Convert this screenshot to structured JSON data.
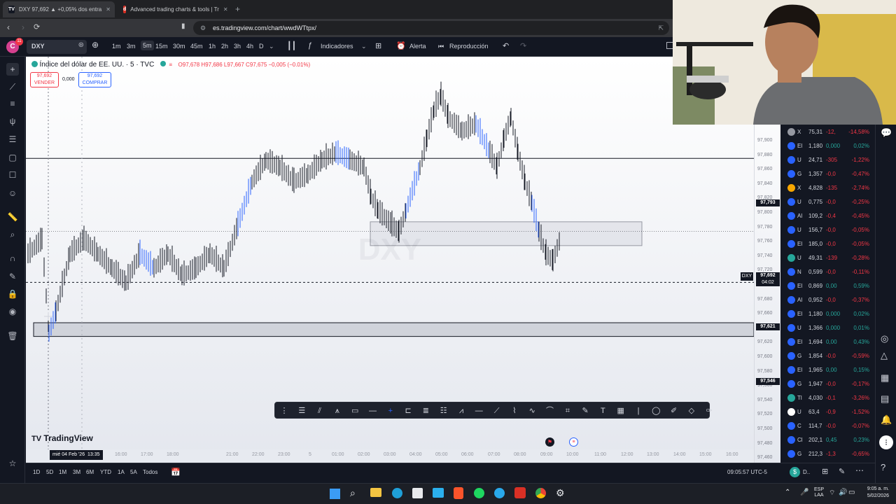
{
  "browser": {
    "tab1": "DXY 97,692 ▲ +0,05% dos entra",
    "tab2": "Advanced trading charts & tools | Tr",
    "url": "es.tradingview.com/chart/wwdWTtpx/"
  },
  "toolbar": {
    "avatar_letter": "C",
    "avatar_badge": "11",
    "symbol": "DXY",
    "timeframes": [
      "1m",
      "3m",
      "5m",
      "15m",
      "30m",
      "45m",
      "1h",
      "2h",
      "3h",
      "4h",
      "D"
    ],
    "active_timeframe": "5m",
    "indicators_label": "Indicadores",
    "alert_label": "Alerta",
    "replay_label": "Reproducción"
  },
  "legend": {
    "title": "Índice del dólar de EE. UU. · 5 · TVC",
    "ohlc": "O97,678 H97,686 L97,667 C97,675 −0,005 (−0.01%)",
    "sell_price": "97,692",
    "sell_label": "VENDER",
    "spread": "0,000",
    "buy_price": "97,692",
    "buy_label": "COMPRAR"
  },
  "price_scale": {
    "labels": [
      "97,900",
      "97,880",
      "97,860",
      "97,840",
      "97,820",
      "97,800",
      "97,780",
      "97,760",
      "97,740",
      "97,720",
      "97,700",
      "97,680",
      "97,660",
      "97,640",
      "97,620",
      "97,600",
      "97,580",
      "97,560",
      "97,540",
      "97,520",
      "97,500",
      "97,480",
      "97,460"
    ],
    "tag_upper": "97,793",
    "current_symbol": "DXY",
    "current_price": "97,692",
    "current_countdown": "04:02",
    "tag_cross": "97,621",
    "tag_lower": "97,546"
  },
  "time_axis": {
    "labels": [
      "12:00",
      "16:00",
      "17:00",
      "18:00",
      "21:00",
      "22:00",
      "23:00",
      "5",
      "01:00",
      "02:00",
      "03:00",
      "04:00",
      "05:00",
      "06:00",
      "07:00",
      "08:00",
      "09:00",
      "10:00",
      "11:00",
      "12:00",
      "13:00",
      "14:00",
      "15:00",
      "16:00"
    ],
    "cursor_date": "mié 04 Feb '26",
    "cursor_time": "13:35"
  },
  "brand": "TradingView",
  "bottom": {
    "ranges": [
      "1D",
      "5D",
      "1M",
      "3M",
      "6M",
      "YTD",
      "1A",
      "5A",
      "Todos"
    ],
    "clock": "09:05:57 UTC-5"
  },
  "watchlist": [
    {
      "s": "X",
      "p": "75,31",
      "c": "-12,",
      "pc": "-14,58%",
      "color": "#9598a1",
      "up": false
    },
    {
      "s": "El",
      "p": "1,180",
      "c": "0,000",
      "pc": "0,02%",
      "color": "#2962ff",
      "up": true
    },
    {
      "s": "U",
      "p": "24,71",
      "c": "-305",
      "pc": "-1,22%",
      "color": "#2962ff",
      "up": false
    },
    {
      "s": "G",
      "p": "1,357",
      "c": "-0,0",
      "pc": "-0,47%",
      "color": "#2962ff",
      "up": false
    },
    {
      "s": "X",
      "p": "4,828",
      "c": "-135",
      "pc": "-2,74%",
      "color": "#f7a600",
      "up": false
    },
    {
      "s": "U",
      "p": "0,775",
      "c": "-0,0",
      "pc": "-0,25%",
      "color": "#2962ff",
      "up": false
    },
    {
      "s": "Al",
      "p": "109,2",
      "c": "-0,4",
      "pc": "-0,45%",
      "color": "#2962ff",
      "up": false
    },
    {
      "s": "U",
      "p": "156,7",
      "c": "-0,0",
      "pc": "-0,05%",
      "color": "#2962ff",
      "up": false
    },
    {
      "s": "El",
      "p": "185,0",
      "c": "-0,0",
      "pc": "-0,05%",
      "color": "#2962ff",
      "up": false
    },
    {
      "s": "U",
      "p": "49,31",
      "c": "-139",
      "pc": "-0,28%",
      "color": "#26a69a",
      "up": false
    },
    {
      "s": "N",
      "p": "0,599",
      "c": "-0,0",
      "pc": "-0,11%",
      "color": "#2962ff",
      "up": false
    },
    {
      "s": "El",
      "p": "0,869",
      "c": "0,00",
      "pc": "0,59%",
      "color": "#2962ff",
      "up": true
    },
    {
      "s": "Al",
      "p": "0,952",
      "c": "-0,0",
      "pc": "-0,37%",
      "color": "#2962ff",
      "up": false
    },
    {
      "s": "El",
      "p": "1,180",
      "c": "0,000",
      "pc": "0,02%",
      "color": "#2962ff",
      "up": true
    },
    {
      "s": "U",
      "p": "1,366",
      "c": "0,000",
      "pc": "0,01%",
      "color": "#2962ff",
      "up": true
    },
    {
      "s": "El",
      "p": "1,694",
      "c": "0,00",
      "pc": "0,43%",
      "color": "#2962ff",
      "up": true
    },
    {
      "s": "G",
      "p": "1,854",
      "c": "-0,0",
      "pc": "-0,59%",
      "color": "#2962ff",
      "up": false
    },
    {
      "s": "El",
      "p": "1,965",
      "c": "0,00",
      "pc": "0,15%",
      "color": "#2962ff",
      "up": true
    },
    {
      "s": "G",
      "p": "1,947",
      "c": "-0,0",
      "pc": "-0,17%",
      "color": "#2962ff",
      "up": false
    },
    {
      "s": "Tl",
      "p": "4,030",
      "c": "-0,1",
      "pc": "-3,26%",
      "color": "#26a69a",
      "up": false
    },
    {
      "s": "U",
      "p": "63,4",
      "c": "-0,9",
      "pc": "-1,52%",
      "color": "#ffffff",
      "up": false
    },
    {
      "s": "C",
      "p": "114,7",
      "c": "-0,0",
      "pc": "-0,07%",
      "color": "#2962ff",
      "up": false
    },
    {
      "s": "Cl",
      "p": "202,1",
      "c": "0,45",
      "pc": "0,23%",
      "color": "#2962ff",
      "up": true
    },
    {
      "s": "G",
      "p": "212,3",
      "c": "-1,3",
      "pc": "-0,65%",
      "color": "#2962ff",
      "up": false
    }
  ],
  "taskbar": {
    "lang": "ESP LAA",
    "time": "9:05 a. m.",
    "date": "5/02/2026"
  },
  "colors": {
    "up": "#26a69a",
    "down": "#f23645",
    "accent": "#2962ff"
  }
}
